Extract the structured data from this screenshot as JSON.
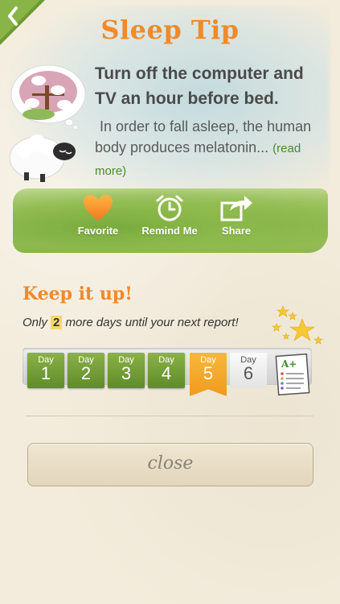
{
  "header": {
    "title": "Sleep Tip"
  },
  "tip": {
    "heading": "Turn off the computer and TV an hour before bed.",
    "body": "In order to fall asleep, the human body produces melatonin...",
    "read_more": "(read more)"
  },
  "actions": [
    {
      "label": "Favorite",
      "icon": "heart-icon"
    },
    {
      "label": "Remind Me",
      "icon": "alarm-clock-icon"
    },
    {
      "label": "Share",
      "icon": "share-icon"
    }
  ],
  "progress": {
    "title": "Keep it up!",
    "subtitle_pre": "Only",
    "days_left": "2",
    "subtitle_post": "more days until your next report!",
    "days": [
      {
        "label": "Day",
        "num": "1",
        "state": "done"
      },
      {
        "label": "Day",
        "num": "2",
        "state": "done"
      },
      {
        "label": "Day",
        "num": "3",
        "state": "done"
      },
      {
        "label": "Day",
        "num": "4",
        "state": "done"
      },
      {
        "label": "Day",
        "num": "5",
        "state": "current"
      },
      {
        "label": "Day",
        "num": "6",
        "state": "future"
      }
    ],
    "report_badge": "A+"
  },
  "footer": {
    "close_label": "close"
  },
  "colors": {
    "accent_orange": "#f08a2a",
    "green": "#6b9a30",
    "read_more_green": "#4c8a2a"
  }
}
